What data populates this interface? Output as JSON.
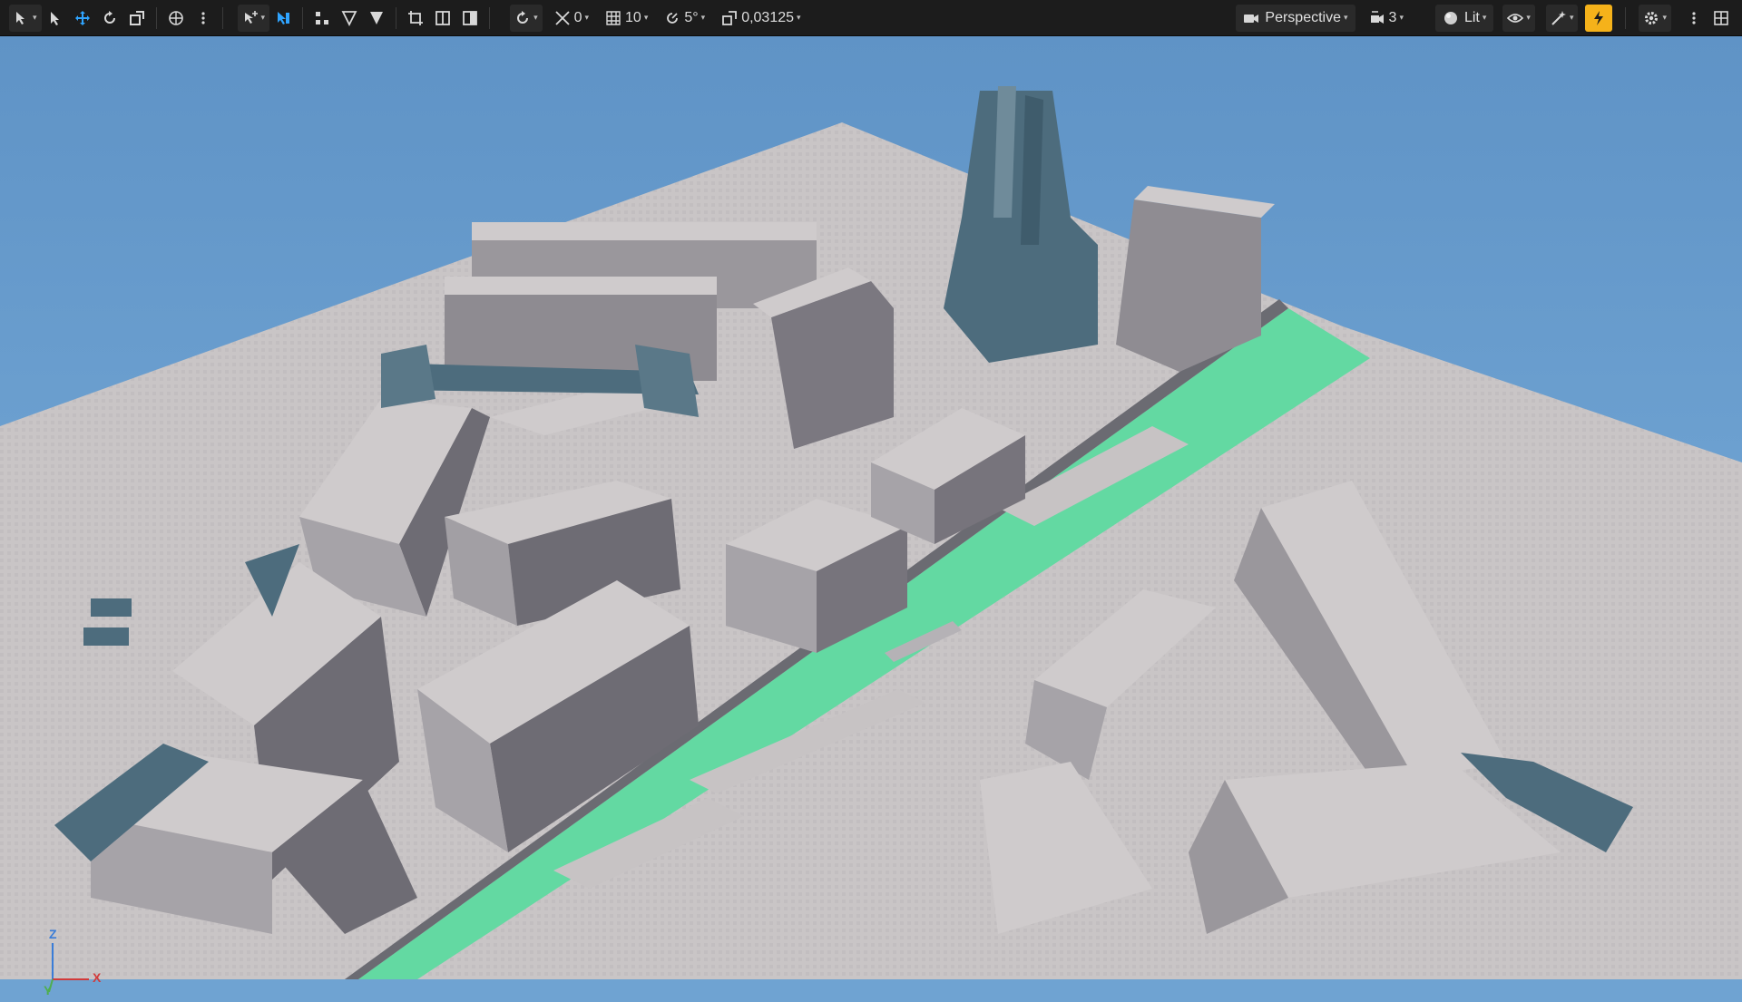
{
  "toolbar": {
    "left_tools": [
      {
        "name": "select-mode-icon"
      },
      {
        "name": "select-arrow-icon"
      },
      {
        "name": "move-icon"
      },
      {
        "name": "rotate-icon"
      },
      {
        "name": "scale-icon"
      },
      {
        "name": "world-coordinates-icon"
      }
    ],
    "snap_angle_value": "0",
    "grid_snap_value": "10",
    "rotation_snap_value": "5°",
    "scale_snap_value": "0,03125",
    "view_mode_label": "Perspective",
    "camera_speed_value": "3",
    "lighting_mode_label": "Lit"
  },
  "viewport": {
    "axis_labels": {
      "z": "Z",
      "x": "X",
      "y": "Y"
    },
    "colors": {
      "sky": "#6fa3d2",
      "ground": "#c9c5c6",
      "building_top": "#cfcbcc",
      "building_side_dark": "#6e6c74",
      "building_side_mid": "#9a979c",
      "structure": "#4d6c7d",
      "water": "#63d9a2",
      "accent": "#f5b21a"
    }
  }
}
